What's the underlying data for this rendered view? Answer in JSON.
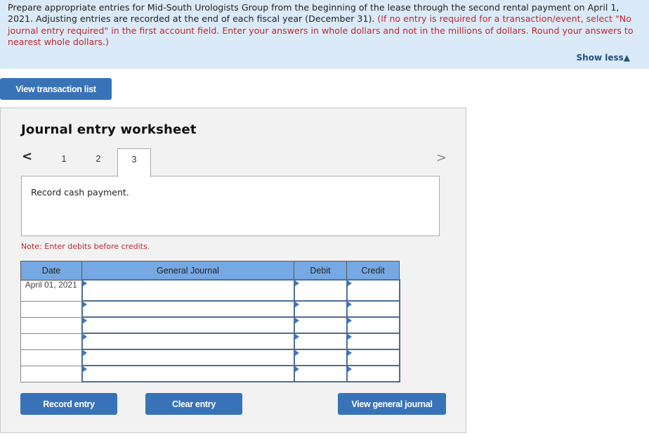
{
  "instructions": {
    "black": "Prepare appropriate entries for Mid-South Urologists Group from the beginning of the lease through the second rental payment on April 1, 2021. Adjusting entries are recorded at the end of each fiscal year (December 31). ",
    "red": "(If no entry is required for a transaction/event, select \"No journal entry required\" in the first account field. Enter your answers in whole dollars and not in the millions of dollars. Round your answers to nearest whole dollars.)",
    "show_less": "Show less▲"
  },
  "buttons": {
    "view_transactions": "View transaction list",
    "record": "Record entry",
    "clear": "Clear entry",
    "view_journal": "View general journal"
  },
  "worksheet": {
    "title": "Journal entry worksheet",
    "prev_icon": "chevron-left",
    "next_icon": "chevron-right",
    "prev_glyph": "<",
    "next_glyph": ">",
    "tabs": [
      {
        "label": "1"
      },
      {
        "label": "2"
      },
      {
        "label": "3"
      }
    ],
    "active_tab": "3",
    "description": "Record cash payment.",
    "note": "Note: Enter debits before credits."
  },
  "table": {
    "headers": [
      "Date",
      "General Journal",
      "Debit",
      "Credit"
    ],
    "rows": [
      {
        "date": "April 01, 2021",
        "account": "",
        "debit": "",
        "credit": ""
      },
      {
        "date": "",
        "account": "",
        "debit": "",
        "credit": ""
      },
      {
        "date": "",
        "account": "",
        "debit": "",
        "credit": ""
      },
      {
        "date": "",
        "account": "",
        "debit": "",
        "credit": ""
      },
      {
        "date": "",
        "account": "",
        "debit": "",
        "credit": ""
      },
      {
        "date": "",
        "account": "",
        "debit": "",
        "credit": ""
      }
    ]
  }
}
